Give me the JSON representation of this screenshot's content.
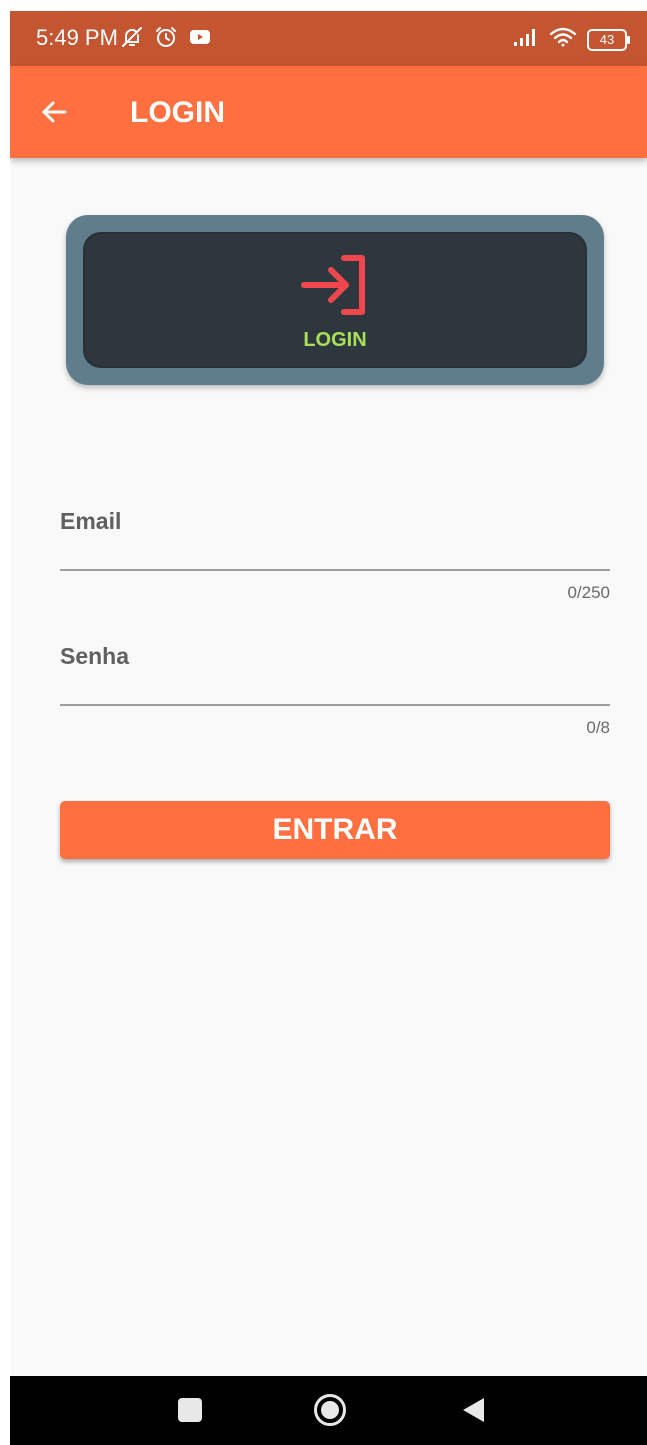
{
  "status_bar": {
    "time": "5:49 PM",
    "battery": "43",
    "icons_left": [
      "notifications-off-icon",
      "alarm-icon",
      "youtube-icon"
    ],
    "icons_right": [
      "signal-icon",
      "wifi-icon",
      "battery-icon"
    ]
  },
  "app_bar": {
    "title": "LOGIN",
    "back_icon": "arrow-left-icon",
    "color": "#ff6f3f"
  },
  "login_card": {
    "icon": "login-icon",
    "label": "LOGIN",
    "icon_color": "#f0474f",
    "label_color": "#a8e05a",
    "outer_color": "#607d8b",
    "inner_color": "#2e373e"
  },
  "form": {
    "email": {
      "label": "Email",
      "value": "",
      "counter": "0/250"
    },
    "password": {
      "label": "Senha",
      "value": "",
      "counter": "0/8"
    },
    "submit_label": "ENTRAR"
  },
  "nav_bar": {
    "buttons": [
      "recents-icon",
      "home-icon",
      "back-icon"
    ]
  }
}
